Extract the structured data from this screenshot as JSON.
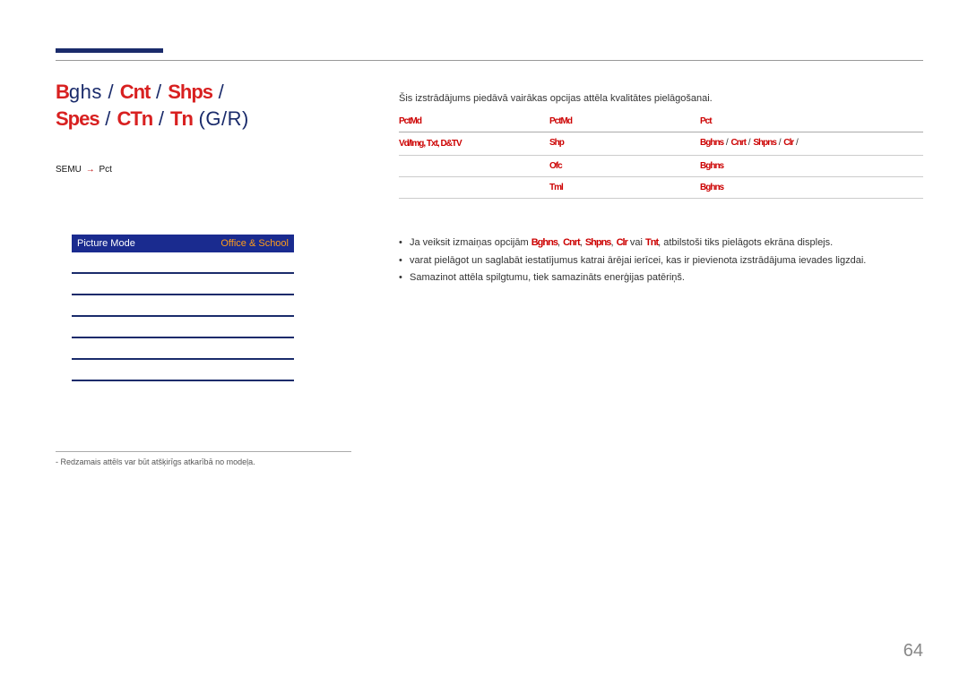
{
  "heading": {
    "line1_a": "B",
    "line1_b": "ghs",
    "line1_c": " / ",
    "line1_d": "Cnt",
    "line1_e": " / ",
    "line1_f": "Shps",
    "line1_g": " / ",
    "line2_a": "Spes",
    "line2_b": " / ",
    "line2_c": "CTn",
    "line2_d": " / ",
    "line2_e": "Tn",
    "line2_f": " (G/R)"
  },
  "breadcrumb": {
    "a": "SEMU",
    "b": "Pct"
  },
  "menu": {
    "active_label": "Picture Mode",
    "active_value": "Office & School"
  },
  "disclaimer": "Redzamais attēls var būt atšķirīgs atkarībā no modeļa.",
  "intro": "Šis izstrādājums piedāvā vairākas opcijas attēla kvalitātes pielāgošanai.",
  "table": {
    "head": {
      "c1": "PctMd",
      "c2": "PctMd",
      "c3": "Pct"
    },
    "rows": [
      {
        "c1a": "Vd/Img",
        "c1b": "Txt",
        "c1c": "D&TV",
        "c2": "Shp",
        "c3_parts": [
          "Bghns",
          " / ",
          "Cnrt",
          " / ",
          "Shpns",
          " / ",
          "Clr",
          " / "
        ]
      },
      {
        "c1": "",
        "c2": "Ofc",
        "c3": "Bghns"
      },
      {
        "c1": "",
        "c2": "Tml",
        "c3": "Bghns"
      }
    ]
  },
  "notes": {
    "n1_a": "Ja veiksit izmaiņas opcijām ",
    "n1_b": "Bghns",
    "n1_c": ", ",
    "n1_d": "Cnrt",
    "n1_e": ", ",
    "n1_f": "Shpns",
    "n1_g": ", ",
    "n1_h": "Clr",
    "n1_i": " vai ",
    "n1_j": "Tnt",
    "n1_k": ", atbilstoši tiks pielāgots ekrāna displejs.",
    "n2": "varat pielāgot un saglabāt iestatījumus katrai ārējai ierīcei, kas ir pievienota izstrādājuma ievades ligzdai.",
    "n3": "Samazinot attēla spilgtumu, tiek samazināts enerģijas patēriņš."
  },
  "page": "64"
}
